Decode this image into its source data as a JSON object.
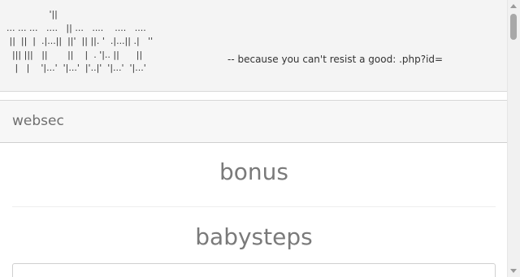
{
  "banner": {
    "ascii_art": "               '||\n... ... ...   ....   || ...   ....    ....   ....\n ||  ||  |  .|...||  ||'  || ||. '  .|...|| .|   ''\n  ||| |||   ||       ||    |  . '|.. ||      ||\n   |   |    '|...'  '|...'  |'..|'  '|...'  '|...'",
    "tagline": "-- because you can't resist a good: .php?id="
  },
  "navbar": {
    "brand": "websec"
  },
  "sections": [
    {
      "title": "bonus"
    },
    {
      "title": "babysteps"
    }
  ]
}
